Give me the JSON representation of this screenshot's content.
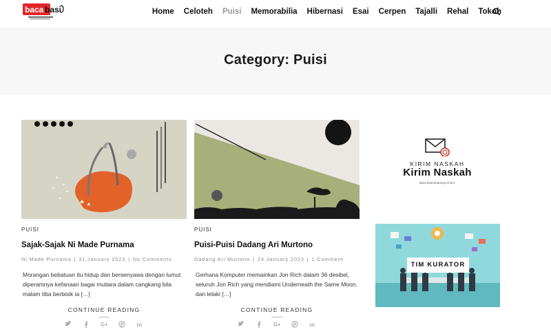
{
  "header": {
    "logo_text": "bacabasi",
    "logo_tagline": "BACA KETERANGANNYA DI SINI",
    "nav": [
      {
        "label": "Home",
        "active": false
      },
      {
        "label": "Celoteh",
        "active": false
      },
      {
        "label": "Puisi",
        "active": true
      },
      {
        "label": "Memorabilia",
        "active": false
      },
      {
        "label": "Hibernasi",
        "active": false
      },
      {
        "label": "Esai",
        "active": false
      },
      {
        "label": "Cerpen",
        "active": false
      },
      {
        "label": "Tajalli",
        "active": false
      },
      {
        "label": "Rehal",
        "active": false
      },
      {
        "label": "Tokoh",
        "active": false
      }
    ],
    "search_icon": "search-icon"
  },
  "page": {
    "title": "Category: Puisi"
  },
  "posts": [
    {
      "category": "PUISI",
      "title": "Sajak-Sajak Ni Made Purnama",
      "author": "Ni Made Purnama",
      "date": "31 January 2023",
      "comments": "No Comments",
      "excerpt": "Morangan bebatuan itu hidup dan bersenyawa dengan lumut diperamnya kefanaan bagai mutiara dalam cangkang bila malam tiba berbisik ia […]",
      "continue": "CONTINUE READING"
    },
    {
      "category": "PUISI",
      "title": "Puisi-Puisi Dadang Ari Murtono",
      "author": "Dadang Ari Murtono",
      "date": "24 January 2023",
      "comments": "1 Comment",
      "excerpt": "Gerhana Komputer memainkan Jon Rich dalam 36 desibel, seluruh Jon Rich yang mendiami Underneath the Same Moon, dan lelaki […]",
      "continue": "CONTINUE READING"
    }
  ],
  "share_icons": [
    "twitter-icon",
    "facebook-icon",
    "google-plus-icon",
    "pinterest-icon",
    "linkedin-icon"
  ],
  "sidebar": {
    "kirim_small": "KIRIM NASKAH",
    "kirim_big": "Kirim Naskah",
    "kirim_tiny": "baca ketentuannya di sini.",
    "kurator_label": "TIM KURATOR"
  },
  "colors": {
    "brand_red": "#e3262a",
    "nav_active": "#9a9a9a",
    "title_band": "#f7f7f7",
    "kurator_bg": "#8fd8dc"
  }
}
